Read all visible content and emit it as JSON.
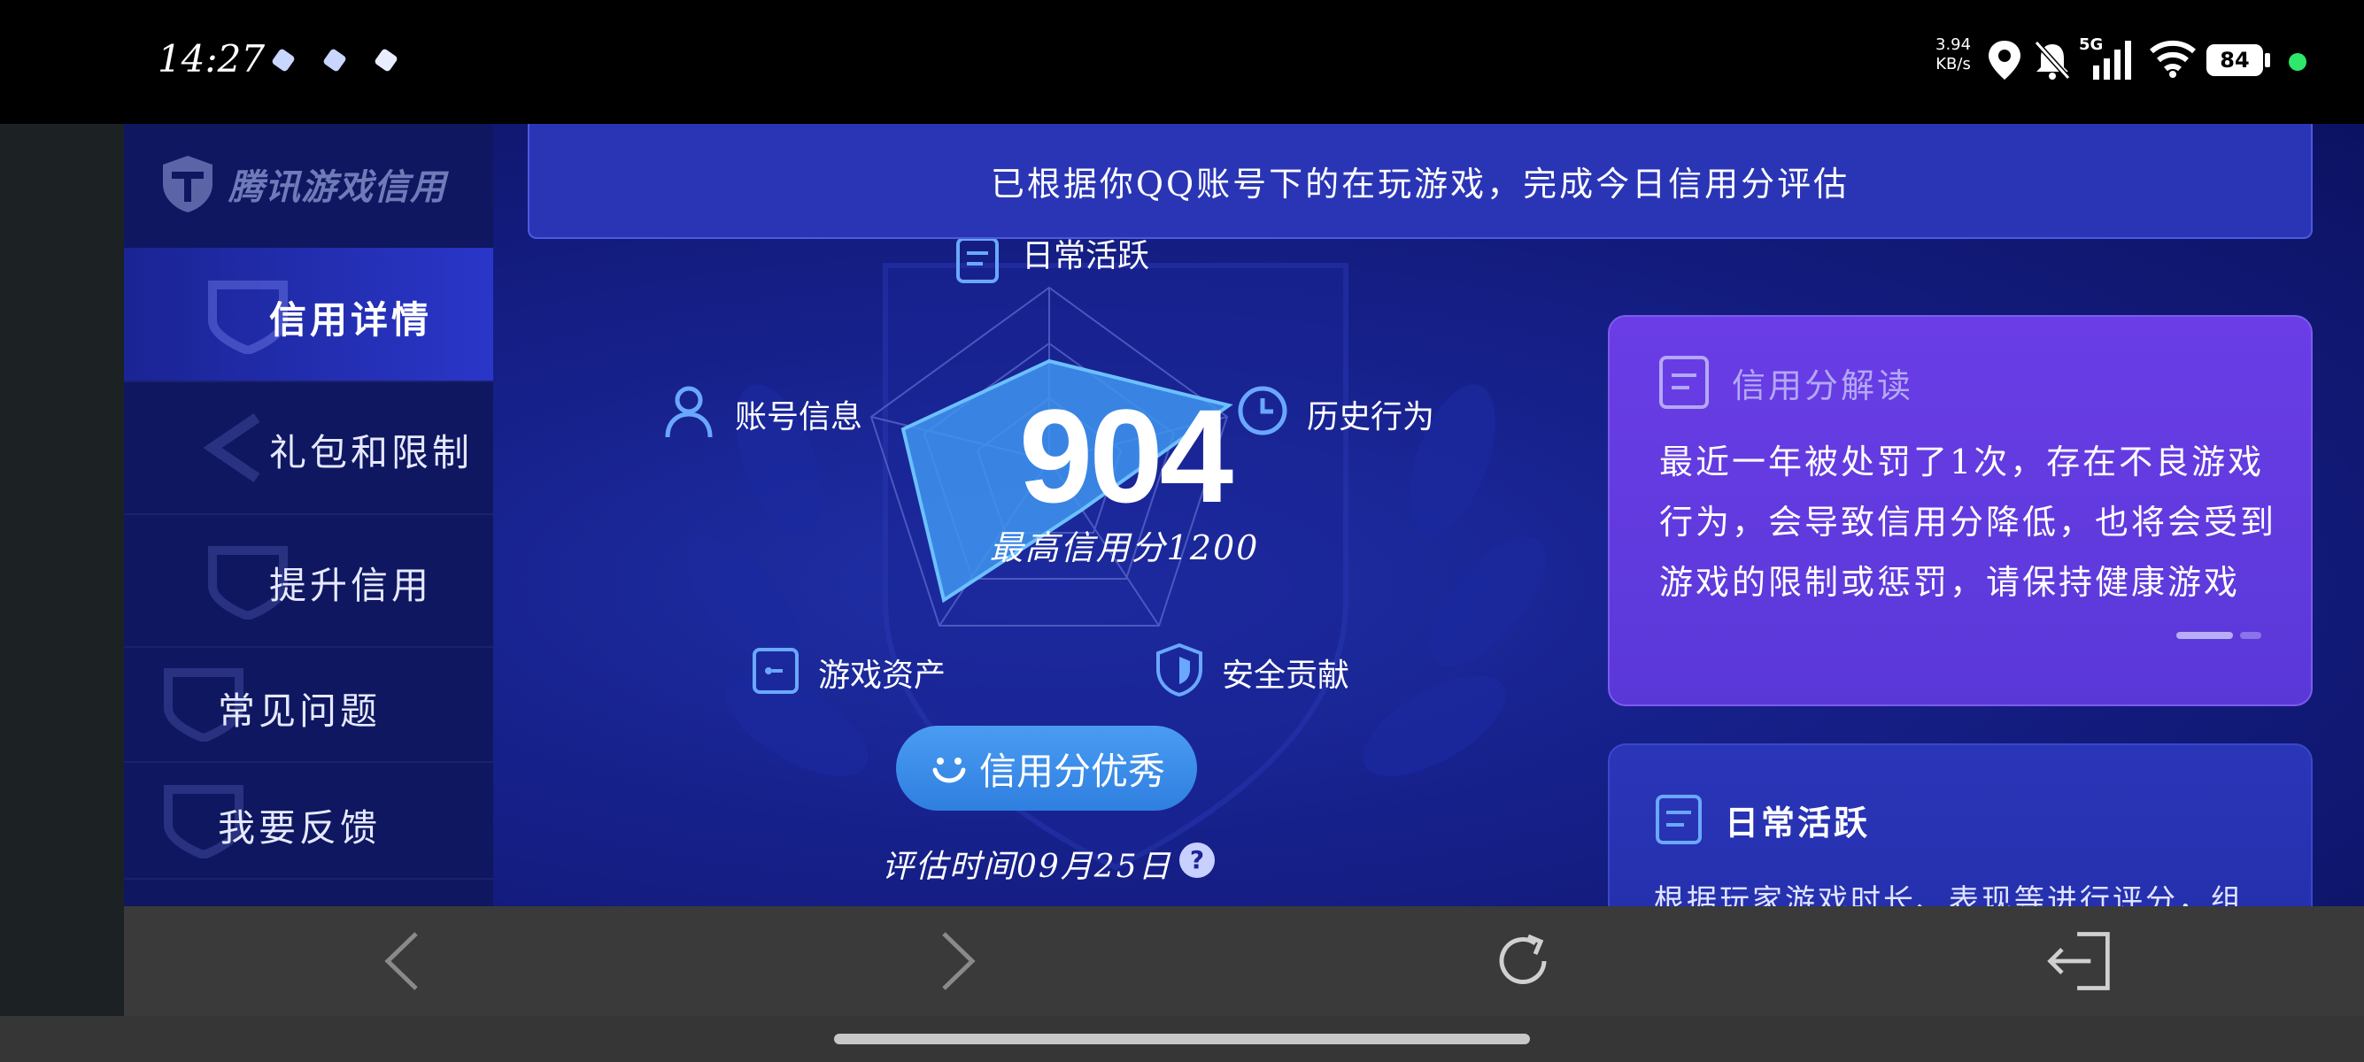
{
  "status_bar": {
    "time": "14:27",
    "net_speed_value": "3.94",
    "net_speed_unit": "KB/s",
    "network": "5G",
    "battery": "84",
    "icons": [
      "location-icon",
      "mute-bell-icon",
      "signal-icon",
      "wifi-icon",
      "battery-icon"
    ]
  },
  "sidebar": {
    "brand": "腾讯游戏信用",
    "items": [
      {
        "label": "信用详情",
        "active": true
      },
      {
        "label": "礼包和限制"
      },
      {
        "label": "提升信用"
      },
      {
        "label": "常见问题"
      },
      {
        "label": "我要反馈"
      }
    ]
  },
  "banner": {
    "text": "已根据你QQ账号下的在玩游戏，完成今日信用分评估"
  },
  "radar": {
    "score": "904",
    "max_label": "最高信用分1200",
    "axes": {
      "top": "日常活跃",
      "left": "账号信息",
      "right": "历史行为",
      "bottom_left": "游戏资产",
      "bottom_right": "安全贡献"
    },
    "status_button": "信用分优秀",
    "eval_time": "评估时间09月25日",
    "help": "?",
    "colors": {
      "fill": "#3f95f0",
      "stroke": "#6cc0ff"
    }
  },
  "interpretation_card": {
    "title": "信用分解读",
    "body": "最近一年被处罚了1次，存在不良游戏行为，会导致信用分降低，也将会受到游戏的限制或惩罚，请保持健康游戏"
  },
  "daily_card": {
    "title": "日常活跃",
    "body": "根据玩家游戏时长、表现等进行评分，组"
  },
  "browser_nav": [
    "back-icon",
    "forward-icon",
    "refresh-icon",
    "exit-icon"
  ]
}
